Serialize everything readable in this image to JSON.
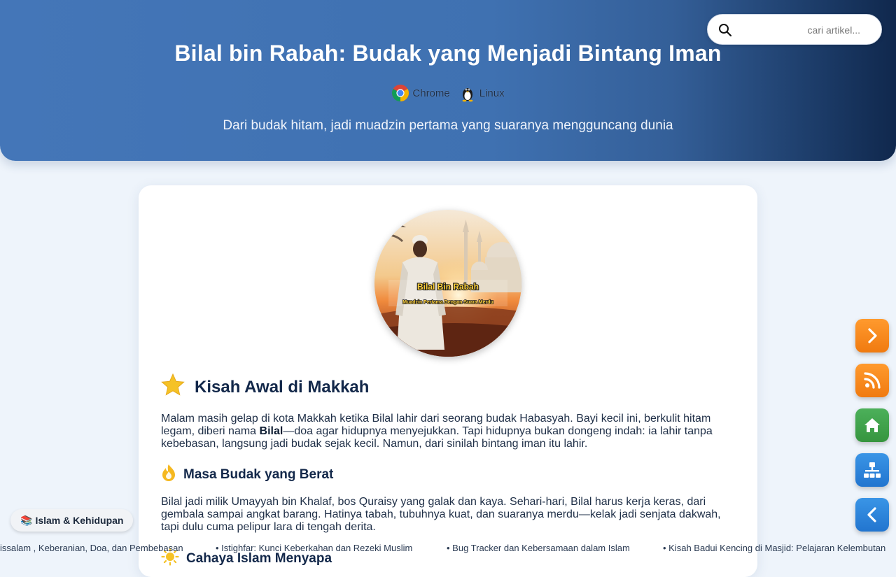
{
  "header": {
    "title": "Bilal bin Rabah: Budak yang Menjadi Bintang Iman",
    "subtitle": "Dari budak hitam, jadi muadzin pertama yang suaranya mengguncang dunia",
    "env": [
      {
        "label": "Chrome",
        "icon": "chrome-icon"
      },
      {
        "label": "Linux",
        "icon": "linux-tux-icon"
      }
    ]
  },
  "search": {
    "placeholder": "cari artikel...",
    "value": ""
  },
  "article": {
    "hero": {
      "caption_title": "Bilal Bin Rabah",
      "caption_sub": "Muadzin Pertama Dengan Suara Merdu"
    },
    "section1": {
      "heading": "Kisah Awal di Makkah",
      "icon": "star-icon",
      "para_before": "Malam masih gelap di kota Makkah ketika Bilal lahir dari seorang budak Habasyah. Bayi kecil ini, berkulit hitam legam, diberi nama ",
      "para_bold": "Bilal",
      "para_after": "—doa agar hidupnya menyejukkan. Tapi hidupnya bukan dongeng indah: ia lahir tanpa kebebasan, langsung jadi budak sejak kecil. Namun, dari sinilah bintang iman itu lahir."
    },
    "section2": {
      "heading": "Masa Budak yang Berat",
      "icon": "fire-icon",
      "para": "Bilal jadi milik Umayyah bin Khalaf, bos Quraisy yang galak dan kaya. Sehari-hari, Bilal harus kerja keras, dari gembala sampai angkat barang. Hatinya tabah, tubuhnya kuat, dan suaranya merdu—kelak jadi senjata dakwah, tapi dulu cuma pelipur lara di tengah derita."
    },
    "section3": {
      "heading": "Cahaya Islam Menyapa",
      "icon": "sun-icon"
    }
  },
  "floating_buttons": [
    {
      "name": "next-arrow-button",
      "icon": "chevron-right-icon",
      "color": "#f58a1f"
    },
    {
      "name": "rss-feed-button",
      "icon": "rss-icon",
      "color": "#f58a1f"
    },
    {
      "name": "home-button",
      "icon": "home-icon",
      "color": "#3fa34d"
    },
    {
      "name": "sitemap-button",
      "icon": "sitemap-icon",
      "color": "#2b82d9"
    },
    {
      "name": "prev-arrow-button",
      "icon": "chevron-left-icon",
      "color": "#2b82d9"
    }
  ],
  "category_badge": {
    "emoji": "📚",
    "label": "Islam & Kehidupan"
  },
  "ticker": [
    "issalam , Keberanian, Doa, dan Pembebasan",
    "Istighfar: Kunci Keberkahan dan Rezeki Muslim",
    "Bug Tracker dan Kebersamaan dalam Islam",
    "Kisah Badui Kencing di Masjid: Pelajaran Kelembutan"
  ],
  "colors": {
    "header_start": "#4476b8",
    "header_end": "#10284d",
    "page_bg": "#eef4fb",
    "heading_text": "#13284a",
    "accent_orange": "#f58a1f",
    "accent_green": "#3fa34d",
    "accent_blue": "#2b82d9"
  }
}
